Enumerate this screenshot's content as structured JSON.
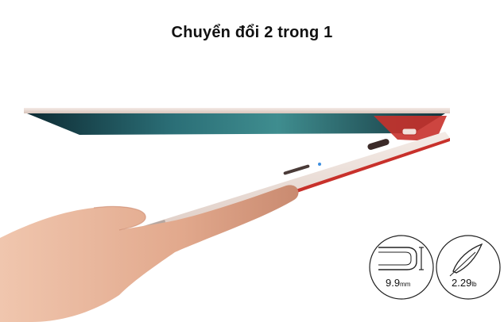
{
  "banner": {
    "title": "Chuyển đổi 2 trong 1"
  },
  "specs": {
    "thickness": {
      "value": "9.9",
      "unit": "mm",
      "icon": "thickness-icon"
    },
    "weight": {
      "value": "2.29",
      "unit": "lb",
      "icon": "feather-icon"
    }
  },
  "colors": {
    "laptop_shell": "#e8d9d2",
    "accent_red": "#c8312b",
    "screen": "#1c5461",
    "skin": "#e9b59a"
  }
}
